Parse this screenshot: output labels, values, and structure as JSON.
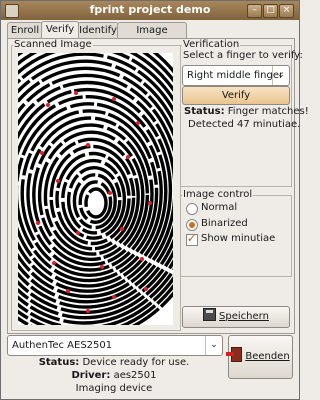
{
  "window": {
    "title": "fprint project demo"
  },
  "tabs": [
    "Enroll",
    "Verify",
    "Identify",
    "Image capture"
  ],
  "active_tab": "Verify",
  "scanned_image": {
    "label": "Scanned Image"
  },
  "verification": {
    "legend": "Verification",
    "prompt": "Select a finger to verify:",
    "finger": "Right middle finger",
    "verify_button": "Verify",
    "status_label": "Status:",
    "status_value": "Finger matches!",
    "minutiae": "Detected 47 minutiae."
  },
  "image_control": {
    "legend": "Image control",
    "options": [
      "Normal",
      "Binarized"
    ],
    "selected": "Binarized",
    "show_minutiae_label": "Show minutiae",
    "show_minutiae": true
  },
  "save_button": "Speichern",
  "device": {
    "name": "AuthenTec AES2501",
    "status_label": "Status:",
    "status_value": "Device ready for use.",
    "driver_label": "Driver:",
    "driver_value": "aes2501",
    "type": "Imaging device"
  },
  "quit_button": "Beenden",
  "colors": {
    "title_bar": "#8d7049",
    "accent": "#d06b19",
    "minutiae": "#e02020"
  },
  "icons": {
    "save": "floppy-disk-icon",
    "quit": "exit-door-icon"
  }
}
